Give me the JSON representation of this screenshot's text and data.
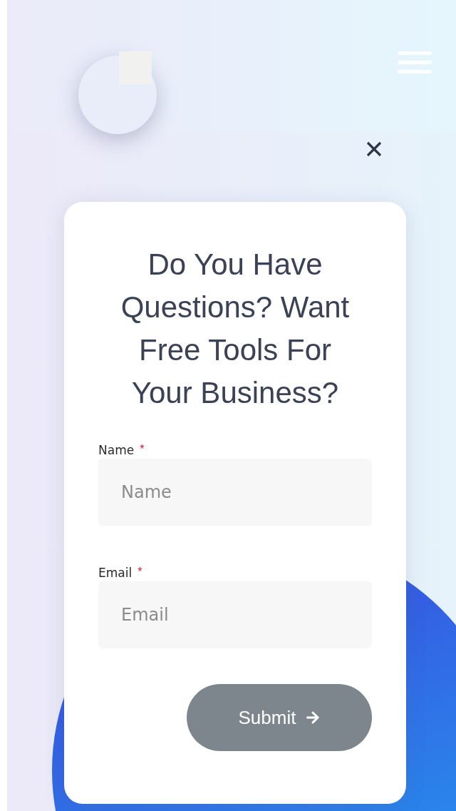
{
  "header": {
    "menu": {
      "open": false
    }
  },
  "popup": {
    "title": "Do You Have Questions? Want Free Tools For Your Business?",
    "fields": [
      {
        "label": "Name",
        "required_mark": "*",
        "placeholder": "Name"
      },
      {
        "label": "Email",
        "required_mark": "*",
        "placeholder": "Email"
      }
    ],
    "submit": {
      "label": "Submit"
    }
  }
}
